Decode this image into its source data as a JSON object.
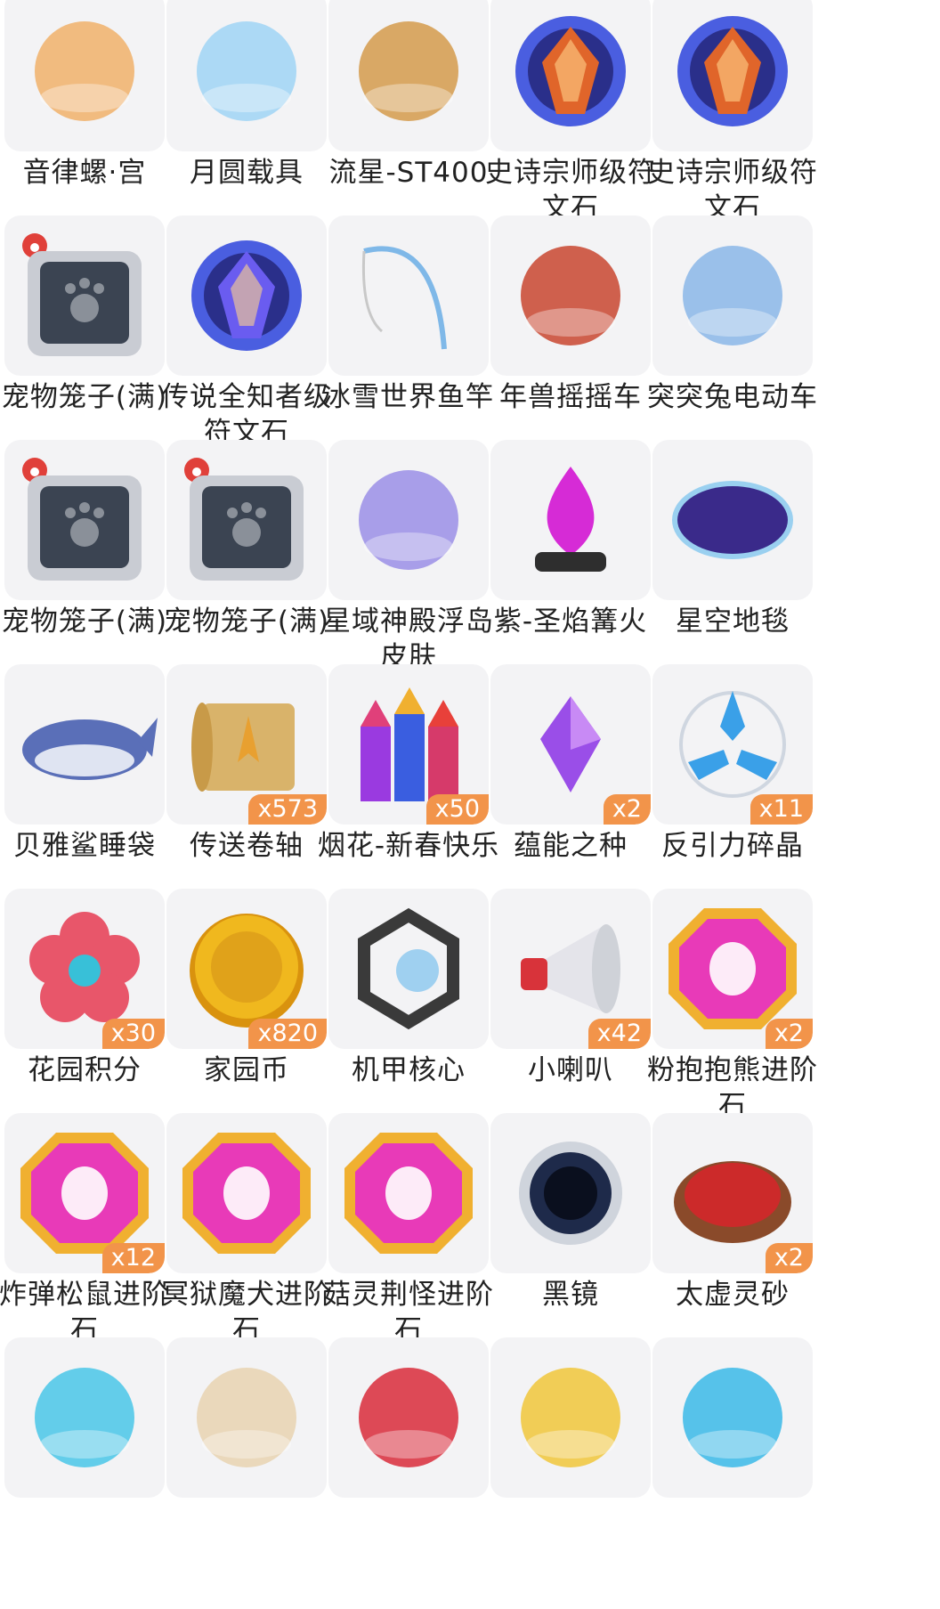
{
  "items": [
    {
      "name": "音律螺·宫",
      "count": "",
      "icon": "conch-palace-icon",
      "color": "#f0b06a"
    },
    {
      "name": "月圆载具",
      "count": "",
      "icon": "full-moon-vehicle-icon",
      "color": "#9fd3f5"
    },
    {
      "name": "流星-ST400",
      "count": "",
      "icon": "meteor-st400-vehicle-icon",
      "color": "#d49a4b"
    },
    {
      "name": "史诗宗师级符文石",
      "count": "",
      "icon": "epic-rune-stone-icon",
      "color": "#e0652a"
    },
    {
      "name": "史诗宗师级符文石",
      "count": "",
      "icon": "epic-rune-stone-icon",
      "color": "#e0652a"
    },
    {
      "name": "宠物笼子(满)",
      "count": "",
      "icon": "pet-cage-icon",
      "color": "#4c5666"
    },
    {
      "name": "传说全知者级符文石",
      "count": "",
      "icon": "legendary-rune-stone-icon",
      "color": "#6a5cf0"
    },
    {
      "name": "冰雪世界鱼竿",
      "count": "",
      "icon": "fishing-rod-icon",
      "color": "#7fb8e8"
    },
    {
      "name": "年兽摇摇车",
      "count": "",
      "icon": "nian-beast-rocking-car-icon",
      "color": "#c8452f"
    },
    {
      "name": "突突兔电动车",
      "count": "",
      "icon": "rabbit-scooter-icon",
      "color": "#8ab6e8"
    },
    {
      "name": "宠物笼子(满)",
      "count": "",
      "icon": "pet-cage-icon",
      "color": "#4c5666"
    },
    {
      "name": "宠物笼子(满)",
      "count": "",
      "icon": "pet-cage-icon",
      "color": "#4c5666"
    },
    {
      "name": "星域神殿浮岛皮肤",
      "count": "",
      "icon": "floating-island-skin-icon",
      "color": "#9a8ee6"
    },
    {
      "name": "紫-圣焰篝火",
      "count": "",
      "icon": "purple-bonfire-icon",
      "color": "#d62bd6"
    },
    {
      "name": "星空地毯",
      "count": "",
      "icon": "starry-carpet-icon",
      "color": "#3a2a8a"
    },
    {
      "name": "贝雅鲨睡袋",
      "count": "",
      "icon": "shark-sleeping-bag-icon",
      "color": "#5a6fb8"
    },
    {
      "name": "传送卷轴",
      "count": "x573",
      "icon": "teleport-scroll-icon",
      "color": "#d9b36a"
    },
    {
      "name": "烟花-新春快乐",
      "count": "x50",
      "icon": "fireworks-icon",
      "color": "#d63a6a"
    },
    {
      "name": "蕴能之种",
      "count": "x2",
      "icon": "energy-seed-crystal-icon",
      "color": "#9a4ee8"
    },
    {
      "name": "反引力碎晶",
      "count": "x11",
      "icon": "anti-gravity-crystal-icon",
      "color": "#3aa0e8"
    },
    {
      "name": "花园积分",
      "count": "x30",
      "icon": "garden-points-flower-icon",
      "color": "#e8566a"
    },
    {
      "name": "家园币",
      "count": "x820",
      "icon": "home-coin-icon",
      "color": "#f0b81e"
    },
    {
      "name": "机甲核心",
      "count": "",
      "icon": "mech-core-icon",
      "color": "#3a3a3a"
    },
    {
      "name": "小喇叭",
      "count": "x42",
      "icon": "megaphone-icon",
      "color": "#d8333a"
    },
    {
      "name": "粉抱抱熊进阶石",
      "count": "x2",
      "icon": "advancement-gem-icon",
      "color": "#e83ab8"
    },
    {
      "name": "炸弹松鼠进阶石",
      "count": "x12",
      "icon": "advancement-gem-icon",
      "color": "#e83ab8"
    },
    {
      "name": "冥狱魔犬进阶石",
      "count": "",
      "icon": "advancement-gem-icon",
      "color": "#e83ab8"
    },
    {
      "name": "菇灵荆怪进阶石",
      "count": "",
      "icon": "advancement-gem-icon",
      "color": "#e83ab8"
    },
    {
      "name": "黑镜",
      "count": "",
      "icon": "black-mirror-icon",
      "color": "#1e2a4a"
    },
    {
      "name": "太虚灵砂",
      "count": "x2",
      "icon": "spirit-sand-icon",
      "color": "#cc2a2a"
    },
    {
      "name": "",
      "count": "",
      "icon": "potion-bottle-icon",
      "color": "#49c6e8"
    },
    {
      "name": "",
      "count": "",
      "icon": "scroll-map-icon",
      "color": "#e8d2b0"
    },
    {
      "name": "",
      "count": "",
      "icon": "red-heart-gem-icon",
      "color": "#d82a3a"
    },
    {
      "name": "",
      "count": "",
      "icon": "gold-ingot-icon",
      "color": "#f0c53a"
    },
    {
      "name": "",
      "count": "",
      "icon": "ice-crystal-icon",
      "color": "#39b8e8"
    }
  ]
}
